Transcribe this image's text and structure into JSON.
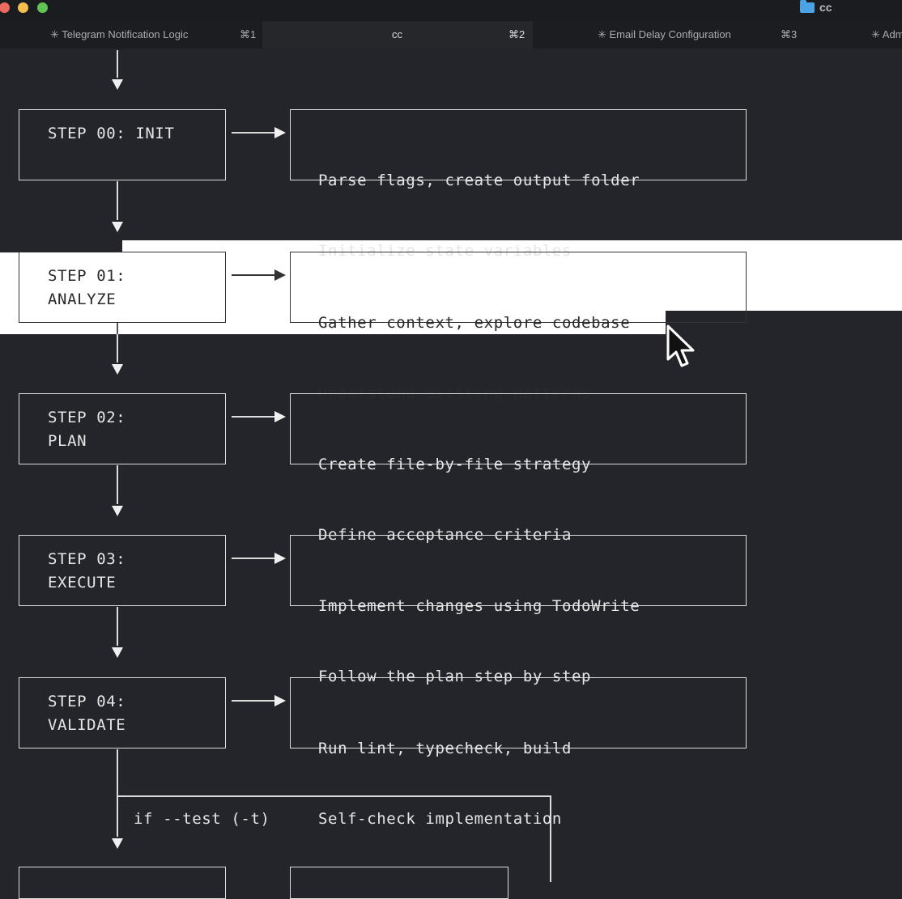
{
  "window": {
    "title": "cc"
  },
  "tabs": [
    {
      "label": "✳ Telegram Notification Logic",
      "shortcut": "⌘1"
    },
    {
      "label": "cc",
      "shortcut": "⌘2"
    },
    {
      "label": "✳ Email Delay Configuration",
      "shortcut": "⌘3"
    },
    {
      "label": "✳ Adm",
      "shortcut": ""
    }
  ],
  "steps": [
    {
      "step": "STEP 00: INIT",
      "desc_line1": "Parse flags, create output folder",
      "desc_line2": "Initialize state variables"
    },
    {
      "step": "STEP 01:\nANALYZE",
      "desc_line1": "Gather context, explore codebase",
      "desc_line2": "Understand existing patterns"
    },
    {
      "step": "STEP 02:\nPLAN",
      "desc_line1": "Create file-by-file strategy",
      "desc_line2": "Define acceptance criteria"
    },
    {
      "step": "STEP 03:\nEXECUTE",
      "desc_line1": "Implement changes using TodoWrite",
      "desc_line2": "Follow the plan step by step"
    },
    {
      "step": "STEP 04:\nVALIDATE",
      "desc_line1": "Run lint, typecheck, build",
      "desc_line2": "Self-check implementation"
    }
  ],
  "condition": {
    "label": "if --test (-t)"
  },
  "icons": {
    "window": "folder-icon",
    "pointer": "mouse-cursor-icon"
  },
  "colors": {
    "background": "#23252a",
    "line": "#dcdcdc",
    "highlight": "#ffffff"
  }
}
